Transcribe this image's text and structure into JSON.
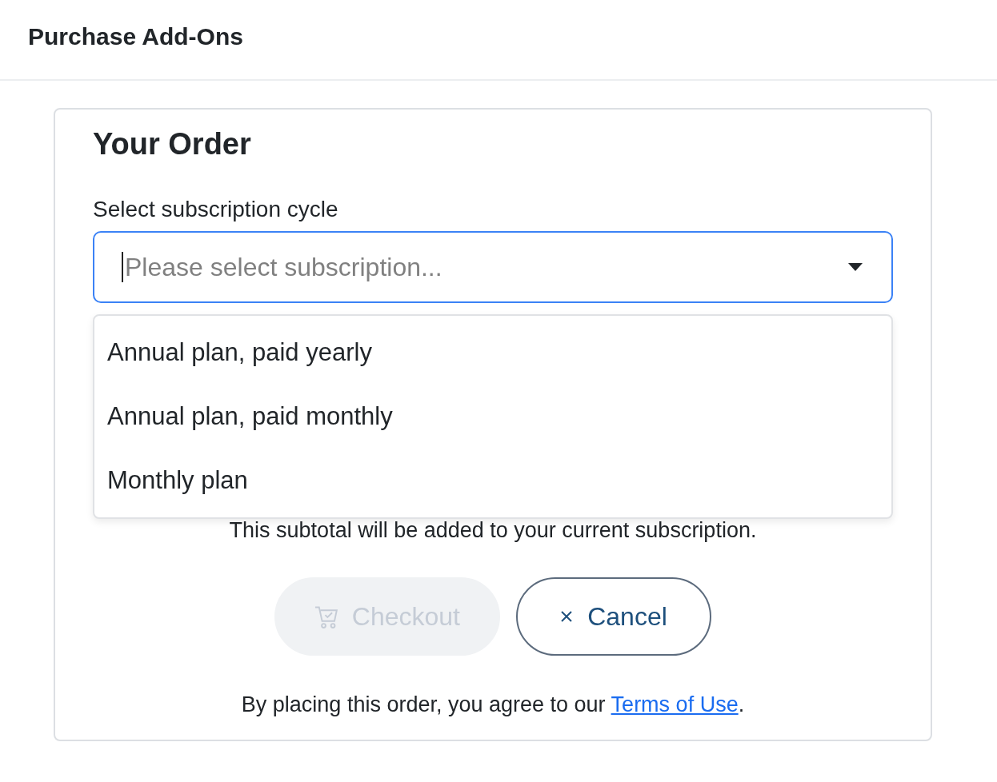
{
  "header": {
    "title": "Purchase Add-Ons"
  },
  "order": {
    "title": "Your Order",
    "subscription": {
      "label": "Select subscription cycle",
      "placeholder": "Please select subscription...",
      "focused": true,
      "expanded": true,
      "options": [
        {
          "label": "Annual plan, paid yearly",
          "selected": false
        },
        {
          "label": "Annual plan, paid monthly",
          "selected": false
        },
        {
          "label": "Monthly plan",
          "selected": false
        }
      ]
    },
    "note": "This subtotal will be added to your current subscription.",
    "buttons": [
      {
        "kind": "checkout",
        "label": "Checkout",
        "disabled": true
      },
      {
        "kind": "cancel",
        "label": "Cancel",
        "disabled": false
      }
    ],
    "terms": {
      "text": "By placing this order, you agree to our ",
      "link": "Terms of Use",
      "end": "."
    }
  }
}
